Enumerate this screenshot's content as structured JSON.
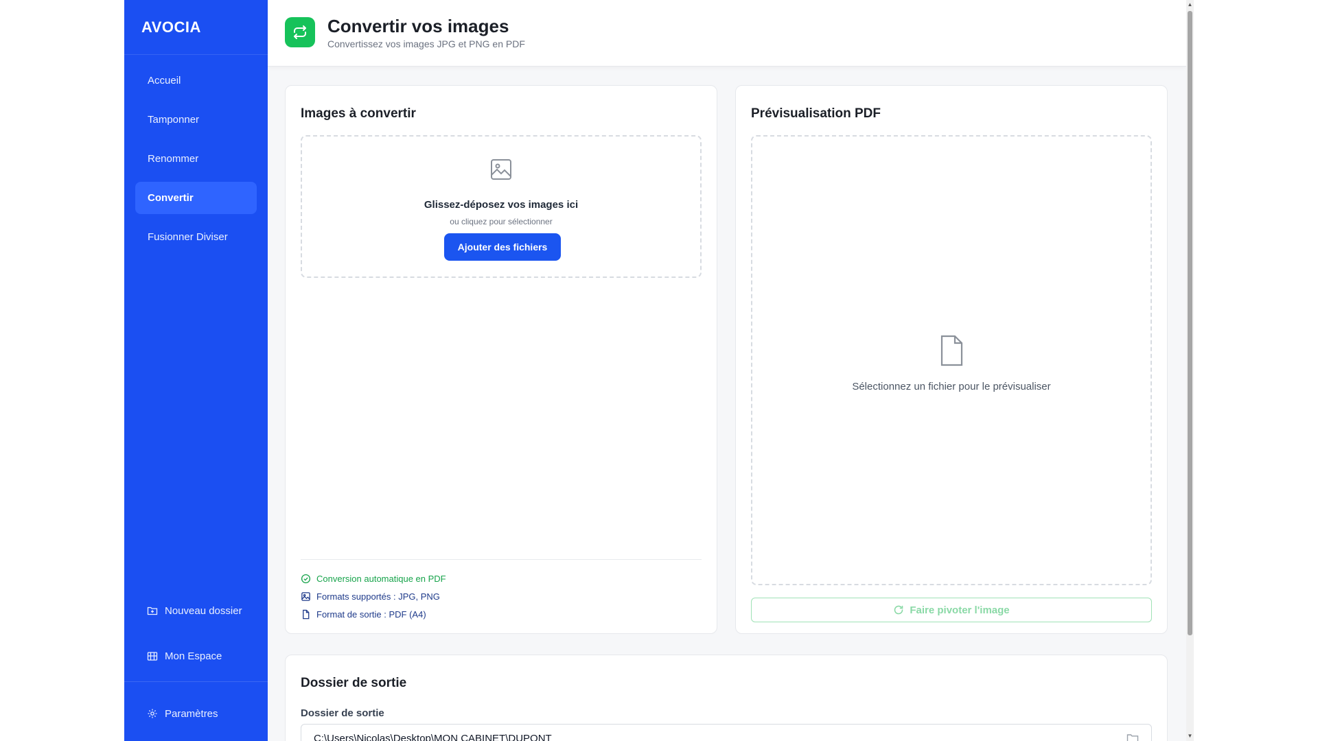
{
  "sidebar": {
    "brand": "AVOCIA",
    "items": [
      {
        "label": "Accueil"
      },
      {
        "label": "Tamponner"
      },
      {
        "label": "Renommer"
      },
      {
        "label": "Convertir",
        "active": true
      },
      {
        "label": "Fusionner Diviser"
      }
    ],
    "new_folder": "Nouveau dossier",
    "my_space": "Mon Espace",
    "settings": "Paramètres"
  },
  "header": {
    "title": "Convertir vos images",
    "subtitle": "Convertissez vos images JPG et PNG en PDF",
    "icon": "swap-arrows-icon",
    "icon_color": "#16c25a"
  },
  "images_card": {
    "title": "Images à convertir",
    "drop_title": "Glissez-déposez vos images ici",
    "drop_sub": "ou cliquez pour sélectionner",
    "add_button": "Ajouter des fichiers",
    "info": [
      {
        "text": "Conversion automatique en PDF",
        "icon": "check-circle-icon"
      },
      {
        "text": "Formats supportés : JPG, PNG",
        "icon": "image-icon"
      },
      {
        "text": "Format de sortie : PDF (A4)",
        "icon": "file-icon"
      }
    ]
  },
  "preview_card": {
    "title": "Prévisualisation PDF",
    "empty_text": "Sélectionnez un fichier pour le prévisualiser",
    "rotate_button": "Faire pivoter l'image"
  },
  "output_card": {
    "title": "Dossier de sortie",
    "label": "Dossier de sortie",
    "path": "C:\\Users\\Nicolas\\Desktop\\MON CABINET\\DUPONT"
  },
  "colors": {
    "sidebar": "#1b4ff2",
    "accent": "#1b55f0",
    "success": "#16a34a"
  }
}
